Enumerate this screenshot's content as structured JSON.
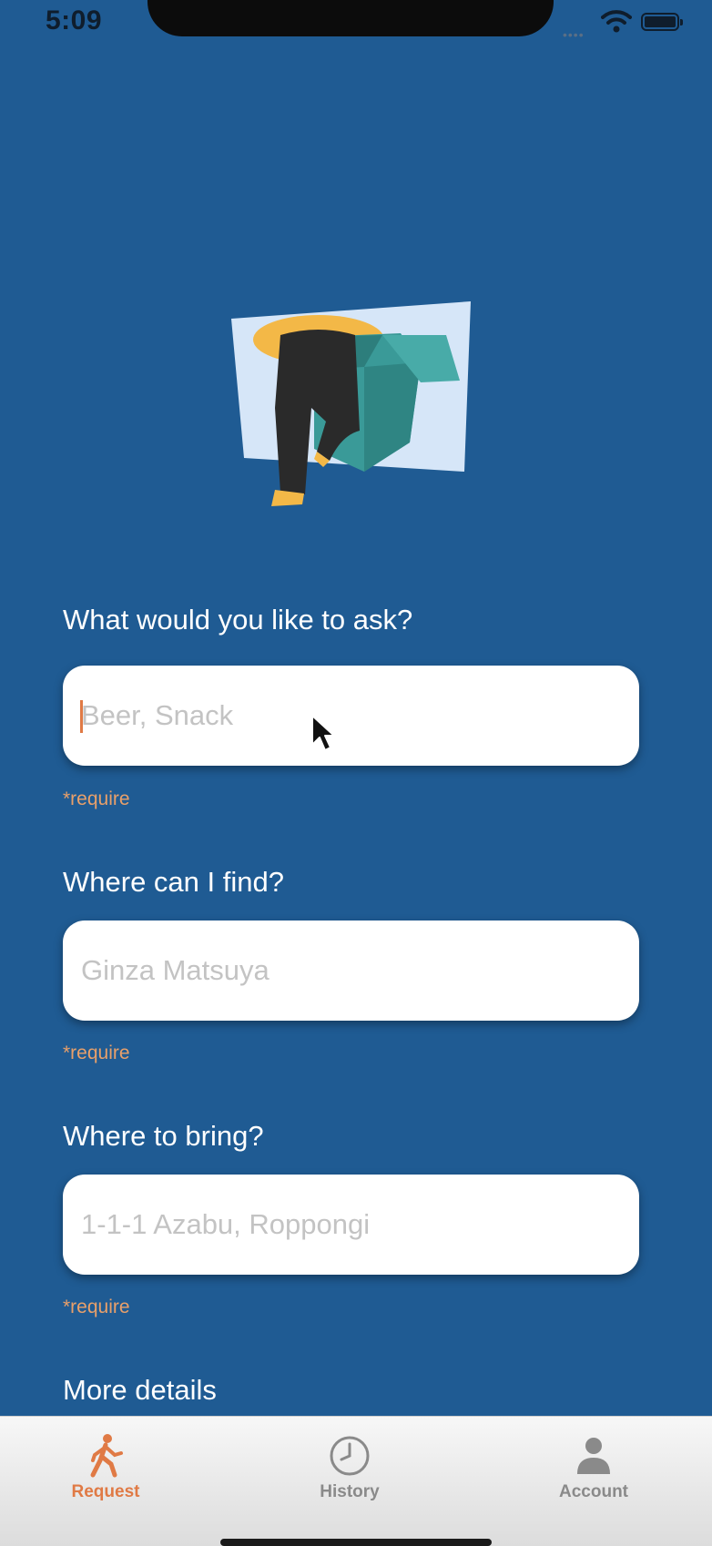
{
  "status_bar": {
    "time": "5:09",
    "signal_icon": "signal-dots-icon",
    "wifi_icon": "wifi-icon",
    "battery_icon": "battery-icon"
  },
  "illustration": {
    "icon": "person-in-box-illustration"
  },
  "form": {
    "ask": {
      "label": "What would you like to ask?",
      "placeholder": "Beer, Snack",
      "value": "",
      "note": "*require"
    },
    "find": {
      "label": "Where can I find?",
      "placeholder": "Ginza Matsuya",
      "value": "",
      "note": "*require"
    },
    "bring": {
      "label": "Where to bring?",
      "placeholder": "1-1-1 Azabu, Roppongi",
      "value": "",
      "note": "*require"
    },
    "details": {
      "label": "More details"
    }
  },
  "tabbar": {
    "tabs": [
      {
        "label": "Request",
        "icon": "walking-person-icon",
        "active": true
      },
      {
        "label": "History",
        "icon": "clock-icon",
        "active": false
      },
      {
        "label": "Account",
        "icon": "person-icon",
        "active": false
      }
    ]
  },
  "colors": {
    "background": "#1f5b93",
    "accent": "#e07a45",
    "require": "#e9a06a",
    "tab_inactive": "#8a8a8a"
  }
}
